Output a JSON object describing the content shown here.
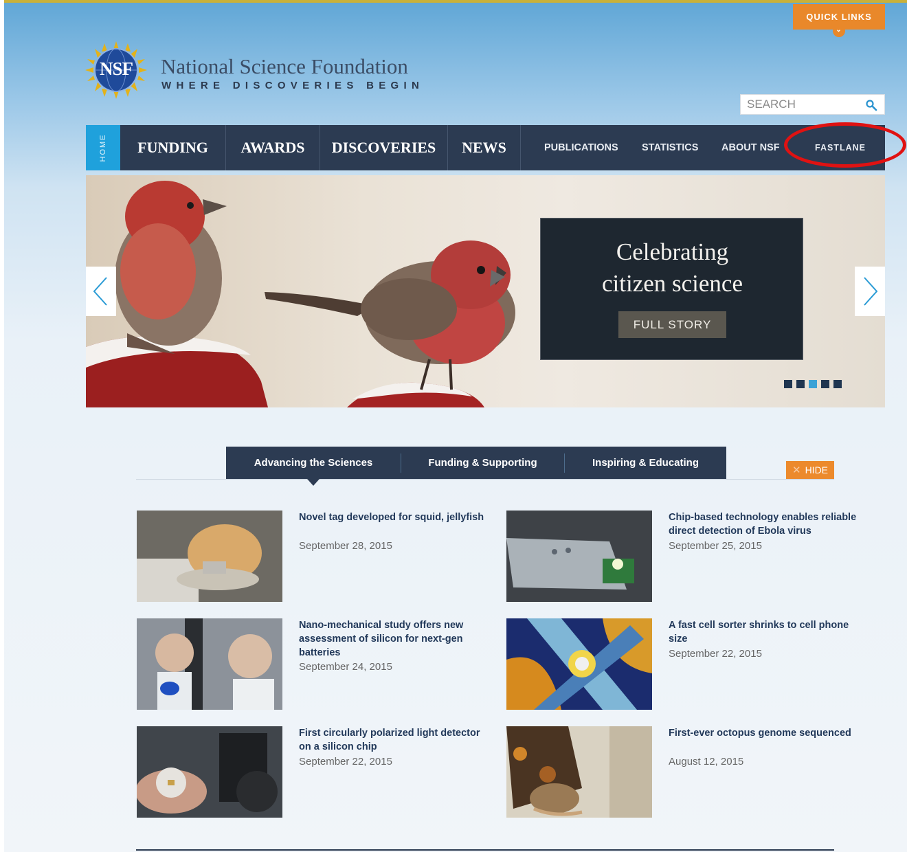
{
  "header": {
    "quick_links": "QUICK LINKS",
    "org_name": "National Science Foundation",
    "tagline": "WHERE DISCOVERIES BEGIN",
    "logo_text": "NSF",
    "search_placeholder": "SEARCH"
  },
  "nav": {
    "home": "HOME",
    "main_items": [
      "FUNDING",
      "AWARDS",
      "DISCOVERIES",
      "NEWS"
    ],
    "sub_items": [
      "PUBLICATIONS",
      "STATISTICS",
      "ABOUT NSF",
      "FASTLANE"
    ]
  },
  "hero": {
    "headline_line1": "Celebrating",
    "headline_line2": "citizen science",
    "button": "FULL STORY",
    "slide_count": 5,
    "active_slide": 3
  },
  "tabs": {
    "items": [
      "Advancing the Sciences",
      "Funding & Supporting",
      "Inspiring & Educating"
    ],
    "active": 0,
    "hide_label": "HIDE"
  },
  "stories": [
    {
      "title": "Novel tag developed for squid, jellyfish",
      "date": "September 28, 2015"
    },
    {
      "title": "Chip-based technology enables reliable direct detection of Ebola virus",
      "date": "September 25, 2015"
    },
    {
      "title": "Nano-mechanical study offers new assessment of silicon for next-gen batteries",
      "date": "September 24, 2015"
    },
    {
      "title": "A fast cell sorter shrinks to cell phone size",
      "date": "September 22, 2015"
    },
    {
      "title": "First circularly polarized light detector on a silicon chip",
      "date": "September 22, 2015"
    },
    {
      "title": "First-ever octopus genome sequenced",
      "date": "August 12, 2015"
    }
  ],
  "colors": {
    "nav_bg": "#2c3b52",
    "home_tab": "#1fa1dc",
    "accent_orange": "#e9882a",
    "highlight_ring": "#e01212"
  }
}
